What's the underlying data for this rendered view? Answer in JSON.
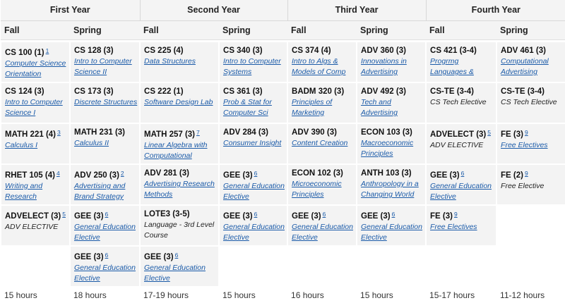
{
  "years": [
    "First Year",
    "Second Year",
    "Third Year",
    "Fourth Year"
  ],
  "semesters": [
    "Fall",
    "Spring",
    "Fall",
    "Spring",
    "Fall",
    "Spring",
    "Fall",
    "Spring"
  ],
  "rows": [
    [
      {
        "code": "CS 100 (1)",
        "note": "1",
        "title": "Computer Science Orientation",
        "link": true
      },
      {
        "code": "CS 128 (3)",
        "title": "Intro to Computer Science II",
        "link": true
      },
      {
        "code": "CS 225 (4)",
        "title": "Data Structures",
        "link": true
      },
      {
        "code": "CS 340 (3)",
        "title": "Intro to Computer Systems",
        "link": true
      },
      {
        "code": "CS 374 (4)",
        "title": "Intro to Algs & Models of Comp",
        "link": true
      },
      {
        "code": "ADV 360 (3)",
        "title": "Innovations in Advertising",
        "link": true
      },
      {
        "code": "CS 421 (3-4)",
        "title": "Progrmg Languages &",
        "link": true
      },
      {
        "code": "ADV 461 (3)",
        "title": "Computational Advertising",
        "link": true
      }
    ],
    [
      {
        "code": "CS 124 (3)",
        "title": "Intro to Computer Science I",
        "link": true
      },
      {
        "code": "CS 173 (3)",
        "title": "Discrete Structures",
        "link": true
      },
      {
        "code": "CS 222 (1)",
        "title": "Software Design Lab",
        "link": true
      },
      {
        "code": "CS 361 (3)",
        "title": "Prob & Stat for Computer Sci",
        "link": true
      },
      {
        "code": "BADM 320 (3)",
        "title": "Principles of Marketing",
        "link": true
      },
      {
        "code": "ADV 492 (3)",
        "title": "Tech and Advertising",
        "link": true
      },
      {
        "code": "CS-TE (3-4)",
        "title": "CS Tech Elective",
        "link": false
      },
      {
        "code": "CS-TE (3-4)",
        "title": "CS Tech Elective",
        "link": false
      }
    ],
    [
      {
        "code": "MATH 221 (4)",
        "note": "3",
        "title": "Calculus I",
        "link": true
      },
      {
        "code": "MATH 231 (3)",
        "title": "Calculus II",
        "link": true
      },
      {
        "code": "MATH 257 (3)",
        "note": "7",
        "title": "Linear Algebra with Computational",
        "link": true
      },
      {
        "code": "ADV 284 (3)",
        "title": "Consumer Insight",
        "link": true
      },
      {
        "code": "ADV 390 (3)",
        "title": "Content Creation",
        "link": true
      },
      {
        "code": "ECON 103 (3)",
        "title": "Macroeconomic Principles",
        "link": true
      },
      {
        "code": "ADVELECT (3)",
        "note": "5",
        "title": "ADV ELECTIVE",
        "link": false
      },
      {
        "code": "FE (3)",
        "note": "9",
        "title": "Free Electives",
        "link": true
      }
    ],
    [
      {
        "code": "RHET 105 (4)",
        "note": "4",
        "title": "Writing and Research",
        "link": true
      },
      {
        "code": "ADV 250 (3)",
        "note": "2",
        "title": "Advertising and Brand Strategy",
        "link": true
      },
      {
        "code": "ADV 281 (3)",
        "title": "Advertising Research Methods",
        "link": true
      },
      {
        "code": "GEE (3)",
        "note": "6",
        "title": "General Education Elective",
        "link": true
      },
      {
        "code": "ECON 102 (3)",
        "title": "Microeconomic Principles",
        "link": true
      },
      {
        "code": "ANTH 103 (3)",
        "title": "Anthropology in a Changing World",
        "link": true
      },
      {
        "code": "GEE (3)",
        "note": "6",
        "title": "General Education Elective",
        "link": true
      },
      {
        "code": "FE (2)",
        "note": "9",
        "title": "Free Elective",
        "link": false
      }
    ],
    [
      {
        "code": "ADVELECT (3)",
        "note": "5",
        "title": "ADV ELECTIVE",
        "link": false
      },
      {
        "code": "GEE (3)",
        "note": "6",
        "title": "General Education Elective",
        "link": true
      },
      {
        "code": "LOTE3 (3-5)",
        "title": "Language - 3rd Level Course",
        "link": false
      },
      {
        "code": "GEE (3)",
        "note": "6",
        "title": "General Education Elective",
        "link": true
      },
      {
        "code": "GEE (3)",
        "note": "6",
        "title": "General Education Elective",
        "link": true
      },
      {
        "code": "GEE (3)",
        "note": "6",
        "title": "General Education Elective",
        "link": true
      },
      {
        "code": "FE (3)",
        "note": "9",
        "title": "Free Electives",
        "link": true
      },
      null
    ],
    [
      null,
      {
        "code": "GEE (3)",
        "note": "6",
        "title": "General Education Elective",
        "link": true
      },
      {
        "code": "GEE (3)",
        "note": "6",
        "title": "General Education Elective",
        "link": true
      },
      null,
      null,
      null,
      null,
      null
    ]
  ],
  "hours": [
    "15 hours",
    "18 hours",
    "17-19 hours",
    "15 hours",
    "16 hours",
    "15 hours",
    "15-17 hours",
    "11-12 hours"
  ]
}
